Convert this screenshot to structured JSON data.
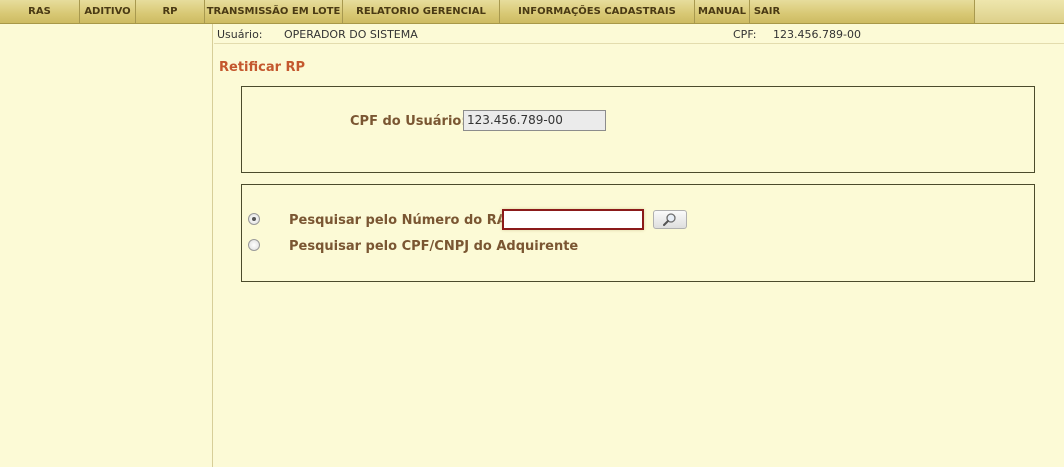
{
  "menu": {
    "items": [
      {
        "label": "RAS"
      },
      {
        "label": "ADITIVO"
      },
      {
        "label": "RP"
      },
      {
        "label": "TRANSMISSÃO EM LOTE"
      },
      {
        "label": "RELATORIO GERENCIAL"
      },
      {
        "label": "INFORMAÇÕES CADASTRAIS"
      },
      {
        "label": "MANUAL"
      },
      {
        "label": "SAIR"
      }
    ]
  },
  "userbar": {
    "user_label": "Usuário:",
    "user_value": "OPERADOR DO SISTEMA",
    "cpf_label": "CPF:",
    "cpf_value": "123.456.789-00"
  },
  "page": {
    "title": "Retificar RP"
  },
  "cpf_section": {
    "label": "CPF do Usuário:",
    "value": "123.456.789-00"
  },
  "search_section": {
    "options": [
      {
        "label": "Pesquisar pelo Número do RAS",
        "selected": true
      },
      {
        "label": "Pesquisar pelo CPF/CNPJ do Adquirente",
        "selected": false
      }
    ],
    "ras_input_value": "",
    "search_button_icon": "magnifier-icon"
  },
  "colors": {
    "background": "#fcfad6",
    "menu_bar": "#d8c874",
    "title": "#c4582e",
    "label": "#7a5632",
    "input_highlight_border": "#8b1a1a"
  }
}
